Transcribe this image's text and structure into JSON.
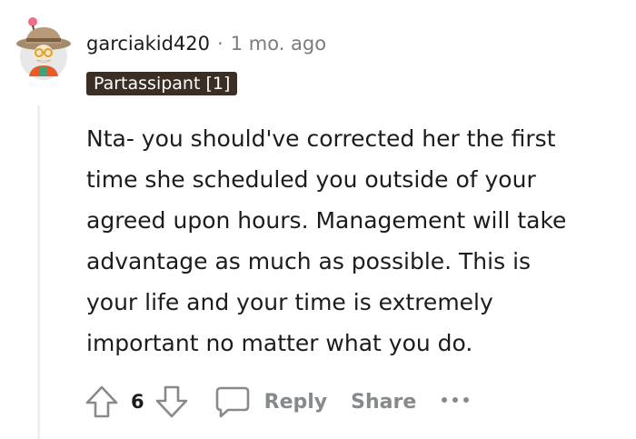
{
  "comment": {
    "username": "garciakid420",
    "separator": "·",
    "timestamp": "1 mo. ago",
    "flair": "Partassipant [1]",
    "body": [
      "Nta- you should've corrected her the first",
      "time she scheduled you outside of your",
      "agreed upon hours. Management will take",
      "advantage as much as possible. This is",
      "your life and your time is extremely",
      "important no matter what you do."
    ],
    "vote_count": "6"
  },
  "actions": {
    "reply_label": "Reply",
    "share_label": "Share",
    "more_label": "•••"
  },
  "colors": {
    "flair_bg": "#3a2e25",
    "muted": "#878a8c",
    "text": "#1c1c1c"
  },
  "icons": [
    "avatar",
    "upvote-icon",
    "downvote-icon",
    "comment-icon",
    "more-icon"
  ]
}
